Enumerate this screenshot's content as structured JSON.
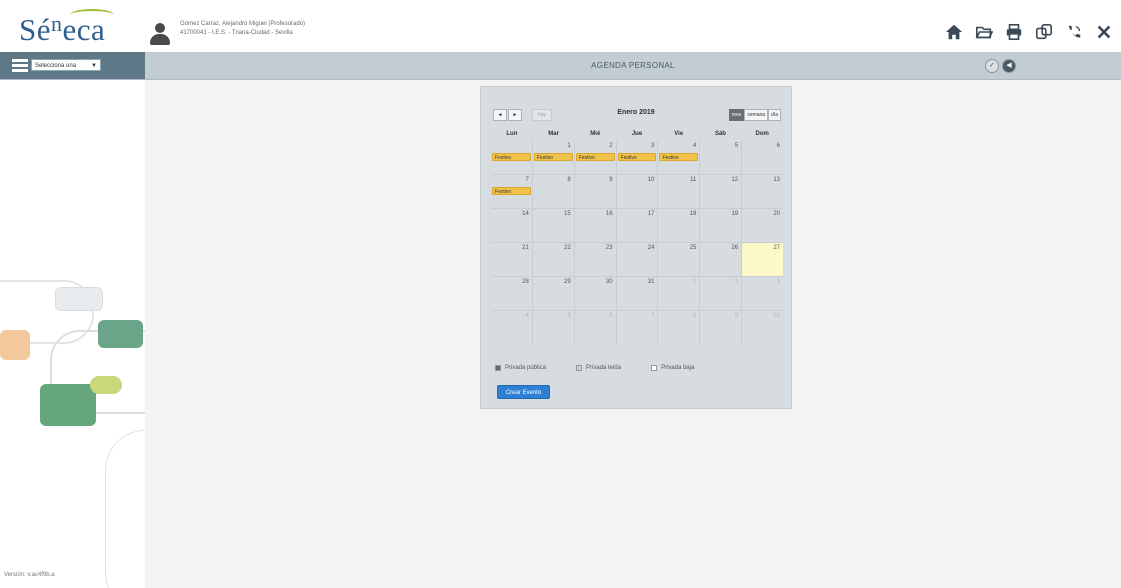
{
  "app": {
    "logo_main": "Sé",
    "logo_sup": "n",
    "logo_end": "eca",
    "user_line1": "Gómez Carraz, Alejandro Miguel (Profesorado)",
    "user_line2": "41700041 - I.E.S. - Triana-Ciudad - Sevilla"
  },
  "toolbar": {
    "icons": [
      "home-icon",
      "folder-icon",
      "print-icon",
      "copy-icon",
      "phone-icon",
      "close-icon"
    ]
  },
  "nav": {
    "select_label": "Selecciona una",
    "title": "AGENDA PERSONAL"
  },
  "sidebar": {
    "version": "Versión: v.ac4f9b.a"
  },
  "calendar": {
    "prev_label": "◄",
    "next_label": "►",
    "today_label": "hoy",
    "month_title": "Enero 2019",
    "views": [
      "mes",
      "semana",
      "día"
    ],
    "active_view": "mes",
    "weekdays": [
      "Lun",
      "Mar",
      "Mié",
      "Jue",
      "Vie",
      "Sáb",
      "Dom"
    ],
    "weeks": [
      [
        {
          "n": "",
          "o": false
        },
        {
          "n": "1",
          "o": false
        },
        {
          "n": "2",
          "o": false
        },
        {
          "n": "3",
          "o": false
        },
        {
          "n": "4",
          "o": false
        },
        {
          "n": "5",
          "o": false
        },
        {
          "n": "6",
          "o": false
        }
      ],
      [
        {
          "n": "7",
          "o": false
        },
        {
          "n": "8",
          "o": false
        },
        {
          "n": "9",
          "o": false
        },
        {
          "n": "10",
          "o": false
        },
        {
          "n": "11",
          "o": false
        },
        {
          "n": "12",
          "o": false
        },
        {
          "n": "13",
          "o": false
        }
      ],
      [
        {
          "n": "14",
          "o": false
        },
        {
          "n": "15",
          "o": false
        },
        {
          "n": "16",
          "o": false
        },
        {
          "n": "17",
          "o": false
        },
        {
          "n": "18",
          "o": false
        },
        {
          "n": "19",
          "o": false
        },
        {
          "n": "20",
          "o": false
        }
      ],
      [
        {
          "n": "21",
          "o": false
        },
        {
          "n": "22",
          "o": false
        },
        {
          "n": "23",
          "o": false
        },
        {
          "n": "24",
          "o": false
        },
        {
          "n": "25",
          "o": false
        },
        {
          "n": "26",
          "o": false
        },
        {
          "n": "27",
          "o": false,
          "today": true
        }
      ],
      [
        {
          "n": "28",
          "o": false
        },
        {
          "n": "29",
          "o": false
        },
        {
          "n": "30",
          "o": false
        },
        {
          "n": "31",
          "o": false
        },
        {
          "n": "1",
          "o": true
        },
        {
          "n": "2",
          "o": true
        },
        {
          "n": "3",
          "o": true
        }
      ],
      [
        {
          "n": "4",
          "o": true
        },
        {
          "n": "5",
          "o": true
        },
        {
          "n": "6",
          "o": true
        },
        {
          "n": "7",
          "o": true
        },
        {
          "n": "8",
          "o": true
        },
        {
          "n": "9",
          "o": true
        },
        {
          "n": "10",
          "o": true
        }
      ]
    ],
    "events": [
      {
        "week": 0,
        "day": 0,
        "label": "Festivo"
      },
      {
        "week": 0,
        "day": 1,
        "label": "Festivo"
      },
      {
        "week": 0,
        "day": 2,
        "label": "Festivo"
      },
      {
        "week": 0,
        "day": 3,
        "label": "Festivo"
      },
      {
        "week": 0,
        "day": 4,
        "label": "Festivo"
      },
      {
        "week": 1,
        "day": 0,
        "label": "Festivo"
      }
    ],
    "legend": [
      "Privada pública",
      "Privada leída",
      "Privada baja"
    ],
    "create_label": "Crear Evento"
  },
  "colors": {
    "brand": "#2f5f8e",
    "event": "#f0c24a",
    "today": "#fdf8c8",
    "create_button": "#2f7fd4"
  }
}
